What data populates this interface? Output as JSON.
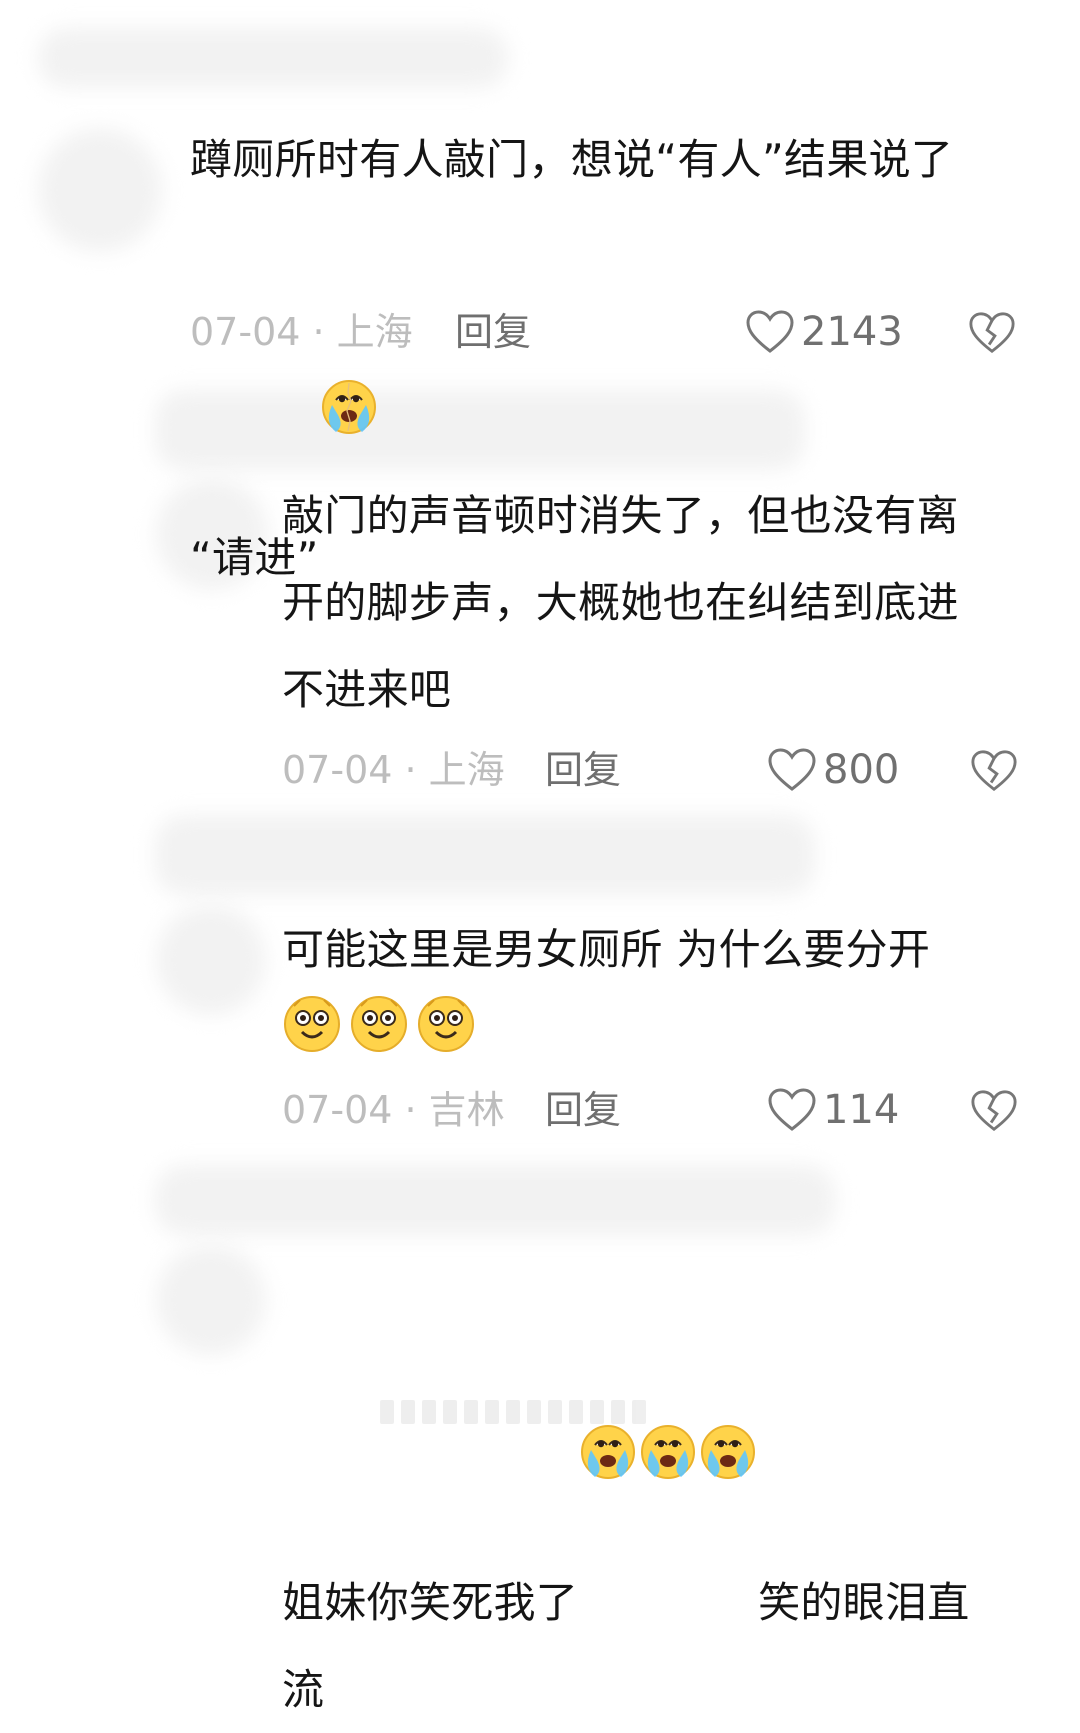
{
  "comments": [
    {
      "text_parts": [
        "蹲厕所时有人敲门，想说“有人”结果说了\n“请进”"
      ],
      "date": "07-04",
      "location": "上海",
      "reply": "回复",
      "likes": "2143"
    },
    {
      "text_parts": [
        "敲门的声音顿时消失了，但也没有离\n开的脚步声，大概她也在纠结到底进\n不进来吧"
      ],
      "date": "07-04",
      "location": "上海",
      "reply": "回复",
      "likes": "800"
    },
    {
      "text_parts": [
        "可能这里是男女厕所 为什么要分开"
      ],
      "date": "07-04",
      "location": "吉林",
      "reply": "回复",
      "likes": "114"
    },
    {
      "text_parts": [
        "姐妹你笑死我了",
        "笑的眼泪直\n流"
      ]
    }
  ],
  "meta_separator": " · ",
  "icons": {
    "like": "heart-outline-icon",
    "dislike": "broken-heart-icon",
    "emoji_cry": "crying-face-emoji",
    "emoji_smile": "smiling-face-emoji"
  }
}
